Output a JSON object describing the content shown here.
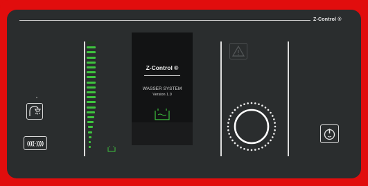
{
  "header": {
    "brand": "Z-Control ®"
  },
  "screen": {
    "brand": "Z-Control ®",
    "title": "WASSER SYSTEM",
    "version": "Version 1.0",
    "status_icon": "water-tank-icon"
  },
  "level_meter": {
    "level_fraction": 0.95,
    "icon": "tank-small-icon"
  },
  "left_controls": [
    {
      "name": "shower-icon"
    },
    {
      "name": "pump-wave-icon"
    }
  ],
  "right_controls": [
    {
      "name": "warning-icon"
    },
    {
      "name": "dial-knob"
    },
    {
      "name": "power-icon"
    }
  ],
  "colors": {
    "frame": "#e10d0d",
    "panel": "#2a2d2e",
    "accent": "#3ec43e"
  }
}
